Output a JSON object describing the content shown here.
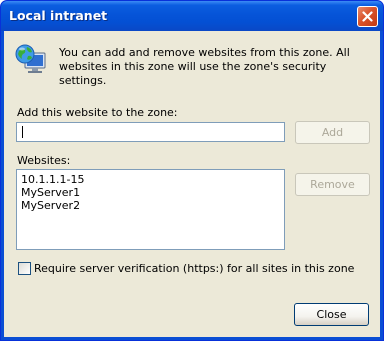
{
  "window": {
    "title": "Local intranet"
  },
  "description": "You can add and remove websites from this zone. All websites in this zone will use the zone's security settings.",
  "add_section": {
    "label": "Add this website to the zone:",
    "input_value": "",
    "add_button": "Add"
  },
  "websites_section": {
    "label": "Websites:",
    "items": [
      "10.1.1.1-15",
      "MyServer1",
      "MyServer2"
    ],
    "remove_button": "Remove"
  },
  "checkbox": {
    "label": "Require server verification (https:) for all sites in this zone",
    "checked": false
  },
  "footer": {
    "close_button": "Close"
  },
  "icons": {
    "title_close": "close-icon",
    "zone": "globe-monitor-icon"
  },
  "colors": {
    "titlebar": "#0654d8",
    "client_bg": "#ece9d8",
    "close_button": "#d9532b"
  }
}
